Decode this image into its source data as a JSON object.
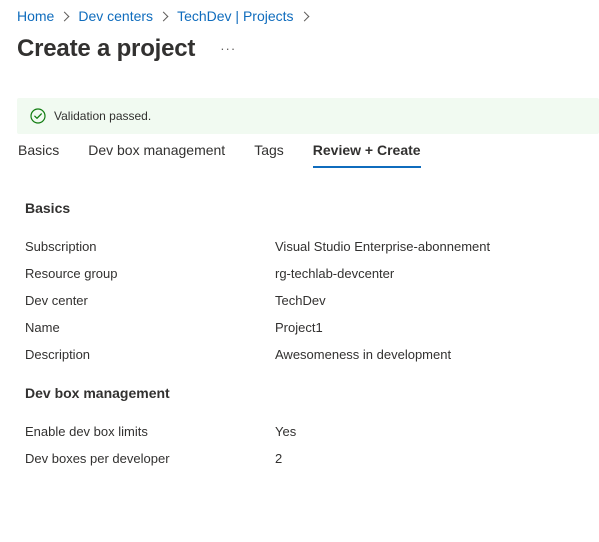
{
  "breadcrumb": {
    "items": [
      "Home",
      "Dev centers",
      "TechDev | Projects"
    ]
  },
  "header": {
    "title": "Create a project",
    "more_label": "···"
  },
  "validation": {
    "message": "Validation passed.",
    "status_color": "#107c10",
    "icon": "check-circle-icon"
  },
  "tabs": [
    {
      "label": "Basics",
      "active": false
    },
    {
      "label": "Dev box management",
      "active": false
    },
    {
      "label": "Tags",
      "active": false
    },
    {
      "label": "Review + Create",
      "active": true
    }
  ],
  "sections": {
    "basics": {
      "title": "Basics",
      "rows": [
        {
          "label": "Subscription",
          "value": "Visual Studio Enterprise-abonnement"
        },
        {
          "label": "Resource group",
          "value": "rg-techlab-devcenter"
        },
        {
          "label": "Dev center",
          "value": "TechDev"
        },
        {
          "label": "Name",
          "value": "Project1"
        },
        {
          "label": "Description",
          "value": "Awesomeness in development"
        }
      ]
    },
    "devbox": {
      "title": "Dev box management",
      "rows": [
        {
          "label": "Enable dev box limits",
          "value": "Yes"
        },
        {
          "label": "Dev boxes per developer",
          "value": "2"
        }
      ]
    }
  },
  "colors": {
    "accent": "#0f6cbd",
    "banner_bg": "#f1faf1"
  }
}
